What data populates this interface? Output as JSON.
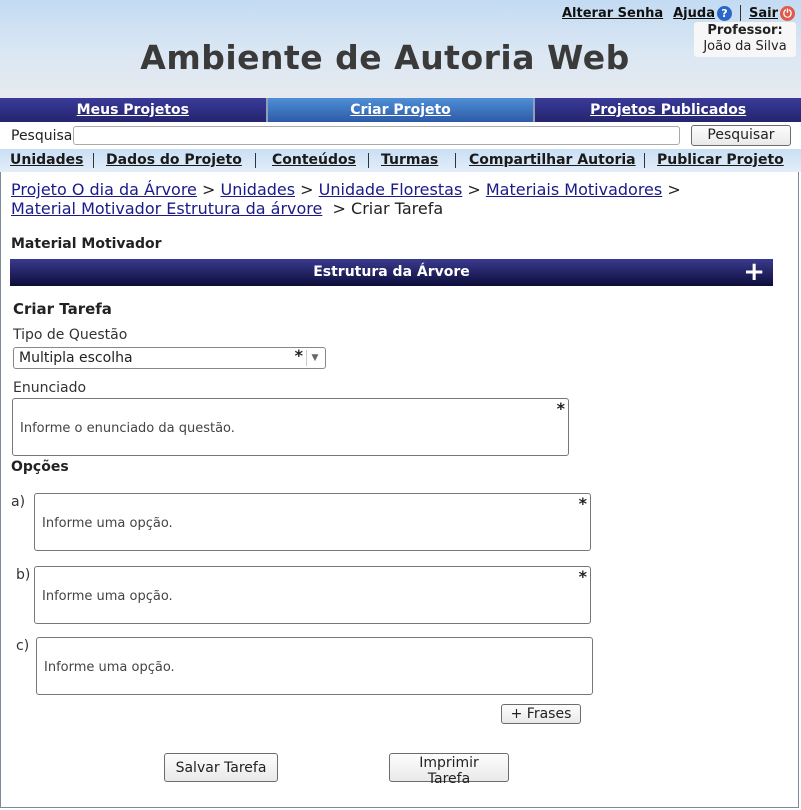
{
  "header": {
    "title": "Ambiente de Autoria Web",
    "links": {
      "change_password": "Alterar Senha",
      "help": "Ajuda",
      "logout": "Sair"
    },
    "user": {
      "label": "Professor:",
      "name": "João da Silva"
    }
  },
  "main_nav": [
    "Meus Projetos",
    "Criar Projeto",
    "Projetos Publicados"
  ],
  "search": {
    "label": "Pesquisa",
    "value": "",
    "button": "Pesquisar"
  },
  "sub_nav": [
    "Unidades",
    "Dados do Projeto",
    "Conteúdos",
    "Turmas",
    "Compartilhar Autoria",
    "Publicar Projeto"
  ],
  "breadcrumb": {
    "items": [
      "Projeto O dia da Árvore",
      "Unidades",
      "Unidade Florestas",
      "Materiais Motivadores",
      "Material Motivador Estrutura da árvore"
    ],
    "current": "Criar Tarefa",
    "separator": ">"
  },
  "material": {
    "heading": "Material Motivador",
    "bar_title": "Estrutura da Árvore",
    "expand_symbol": "+"
  },
  "form": {
    "heading": "Criar Tarefa",
    "question_type_label": "Tipo de Questão",
    "question_type_value": "Multipla escolha",
    "statement_label": "Enunciado",
    "statement_placeholder": "Informe o enunciado da questão.",
    "options_label": "Opções",
    "options": [
      {
        "letter": "a)",
        "placeholder": "Informe uma opção."
      },
      {
        "letter": "b)",
        "placeholder": "Informe uma opção."
      },
      {
        "letter": "c)",
        "placeholder": "Informe uma opção."
      }
    ],
    "required_mark": "*",
    "phrases_button": "+ Frases",
    "save_button": "Salvar Tarefa",
    "print_button": "Imprimir Tarefa"
  }
}
